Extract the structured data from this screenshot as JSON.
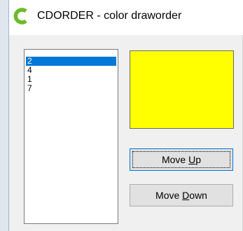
{
  "window": {
    "title": "CDORDER - color draworder"
  },
  "listbox": {
    "items": [
      "2",
      "4",
      "1",
      "7"
    ],
    "selected_index": 0
  },
  "swatch": {
    "color": "#ffff00"
  },
  "buttons": {
    "move_up": {
      "label_before": "Move ",
      "label_mnemonic": "U",
      "label_after": "p"
    },
    "move_down": {
      "label_before": "Move ",
      "label_mnemonic": "D",
      "label_after": "own"
    }
  },
  "colors": {
    "selection": "#0078d7",
    "icon_green": "#6cbb2a"
  },
  "icons": {
    "app": "cdorder-c-icon"
  }
}
